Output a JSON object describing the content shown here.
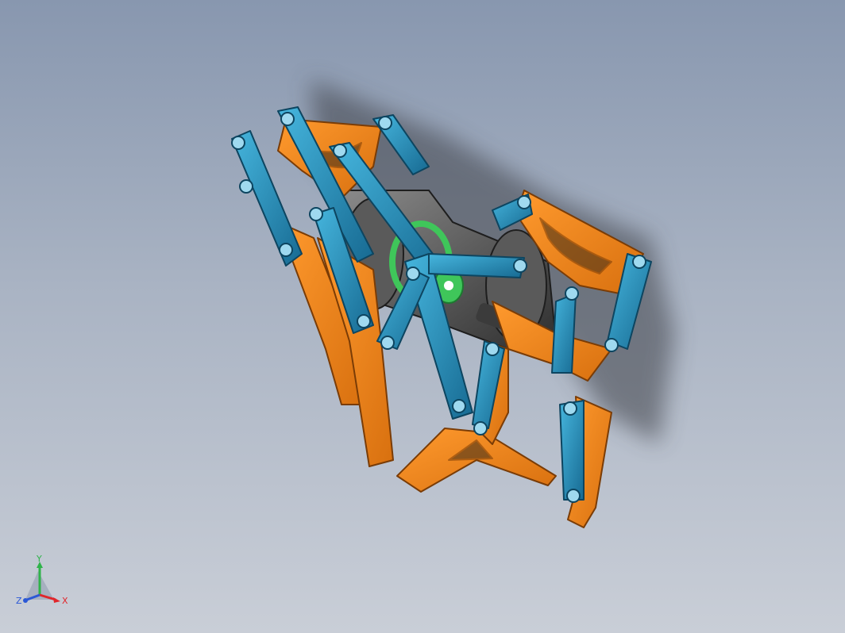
{
  "viewport": {
    "title": "",
    "background_top": "#8897af",
    "background_bottom": "#c9ced7"
  },
  "model": {
    "description_colors": {
      "link_blue": "#1f7fa8",
      "link_blue_light": "#33a7d1",
      "plate_orange": "#f0821a",
      "plate_orange_dark": "#b85a0c",
      "frame_gray": "#4a4a4a",
      "gear_green": "#3fc65a"
    }
  },
  "triad": {
    "x_label": "X",
    "y_label": "Y",
    "z_label": "Z",
    "x_color": "#e0262b",
    "y_color": "#2fb34a",
    "z_color": "#2b58d6"
  }
}
